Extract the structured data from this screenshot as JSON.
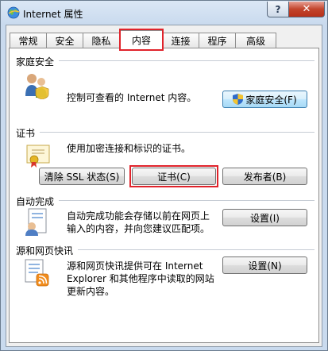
{
  "window": {
    "title": "Internet 属性",
    "help_label": "?",
    "close_label": "✕"
  },
  "tabs": [
    {
      "label": "常规"
    },
    {
      "label": "安全"
    },
    {
      "label": "隐私"
    },
    {
      "label": "内容",
      "selected": true
    },
    {
      "label": "连接"
    },
    {
      "label": "程序"
    },
    {
      "label": "高级"
    }
  ],
  "family_safety": {
    "title": "家庭安全",
    "description": "控制可查看的 Internet 内容。",
    "button_label": "家庭安全(F)"
  },
  "certificates": {
    "title": "证书",
    "description": "使用加密连接和标识的证书。",
    "clear_ssl_label": "清除 SSL 状态(S)",
    "certificates_label": "证书(C)",
    "publishers_label": "发布者(B)"
  },
  "autocomplete": {
    "title": "自动完成",
    "description_line1": "自动完成功能会存储以前在网页上",
    "description_line2": "输入的内容，并向您建议匹配项。",
    "settings_label": "设置(I)"
  },
  "feeds": {
    "title": "源和网页快讯",
    "description_line1": "源和网页快讯提供可在 Internet",
    "description_line2": "Explorer 和其他程序中读取的网站",
    "description_line3": "更新内容。",
    "settings_label": "设置(N)"
  },
  "colors": {
    "highlight": "#e0232b",
    "title_bar": "#c9daee",
    "close_button": "#c2442c"
  }
}
